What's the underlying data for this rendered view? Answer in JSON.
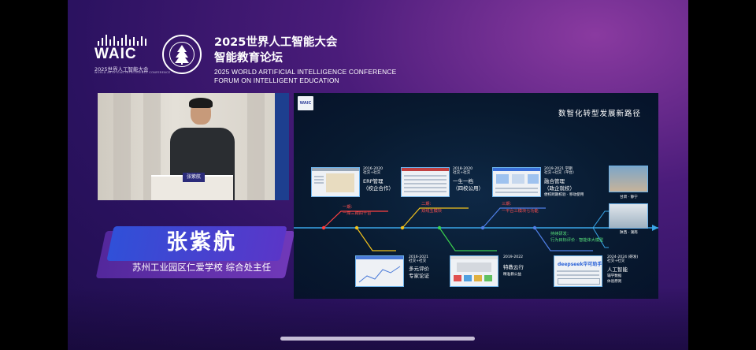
{
  "header": {
    "waic_logo_text": "WAIC",
    "waic_cn": "2025世界人工智能大会",
    "waic_en": "WORLD ARTIFICIAL INTELLIGENCE CONFERENCE",
    "title_cn_line1": "2025世界人工智能大会",
    "title_cn_line2": "智能教育论坛",
    "title_en_line1": "2025 WORLD ARTIFICIAL INTELLIGENCE CONFERENCE",
    "title_en_line2": "FORUM ON INTELLIGENT EDUCATION"
  },
  "video": {
    "podium_tag": "张紫航"
  },
  "speaker": {
    "name": "张紫航",
    "title": "苏州工业园区仁爱学校  综合处主任"
  },
  "slide": {
    "logo": "WAIC",
    "title": "数智化转型发展新路径",
    "above": [
      {
        "date": "2016-2020\n社交+社交",
        "head": "ERP管理",
        "sub": "（校企合作）"
      },
      {
        "date": "2018-2020\n社交+社交",
        "head": "一生一档",
        "sub": "（四校公用）"
      },
      {
        "date": "2019-2021 学期\n社交+社交（平台）",
        "head": "融合管理",
        "sub": "（政企就校）",
        "note": "便校跨期校验  ·  移动使用"
      },
      {
        "date": "",
        "head": "",
        "sub": "",
        "note": "甘肃 · 静宁"
      }
    ],
    "phases": [
      {
        "label": "一期：",
        "sub": "一岸三跨四十台"
      },
      {
        "label": "二期：",
        "sub": "双线五模块"
      },
      {
        "label": "三期：",
        "sub": "一平台三模块七功能"
      }
    ],
    "green_title": "持续研发：",
    "green_sub": "行为目标评价 · 智能体大模型",
    "right_photo_caption": "陕西 · 潮南",
    "below": [
      {
        "date": "2016-2021\n社交+社交",
        "head": "多元评价",
        "sub": "专家论证"
      },
      {
        "date": "2019-2022",
        "head": "特教云行",
        "sub": "精准教公益"
      },
      {
        "date": "2024-2024 (研发)\n社交+社交",
        "head": "人工智能",
        "sub": "辅学数据",
        "sub2": "体验原则"
      }
    ],
    "deepseek_text": "deepseek华可助手"
  },
  "colors": {
    "stage_bg": "#2b1260",
    "slide_bg": "#081a30",
    "timeline": "#3aa6e8",
    "red": "#ff4040",
    "yellow": "#f2c21c",
    "green": "#3ad04f",
    "blue": "#4f7fe6"
  }
}
